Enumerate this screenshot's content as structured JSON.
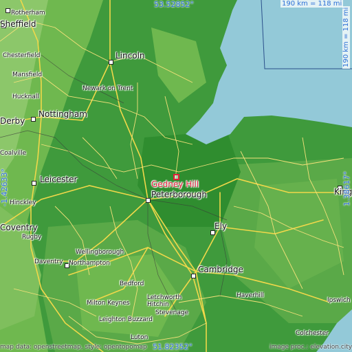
{
  "map": {
    "highlighted_place": "Gedney Hill",
    "coordinates": {
      "top": "53.52852°",
      "bottom": "51.82352°",
      "left": "-1.42633°",
      "right": "1.38617°"
    },
    "scale": {
      "horizontal": "190 km = 118 mi",
      "vertical": "190 km = 118 mi"
    },
    "credits": {
      "left": "map data: openstreetmap, style: opentopomap",
      "right": "image proc.: elevation.city"
    },
    "colors": {
      "sea": "#93c9d8",
      "lowland": "#3f9a3c",
      "upland": "#6fb84f",
      "roads": "#f1d84a",
      "highlight": "#e0203a",
      "coordinate_text": "#2b6fd6"
    },
    "cities": {
      "rotherham": "Rotherham",
      "sheffield": "Sheffield",
      "chesterfield": "Chesterfield",
      "mansfield": "Mansfield",
      "lincoln": "Lincoln",
      "newark": "Newark on Trent",
      "hucknall": "Hucknall",
      "derby": "Derby",
      "nottingham": "Nottingham",
      "coalville": "Coalville",
      "leicester": "Leicester",
      "hinckley": "Hinckley",
      "peterborough": "Peterborough",
      "kings_lynn": "King's Lynn",
      "ely": "Ely",
      "coventry": "Coventry",
      "rugby": "Rugby",
      "wellingborough": "Wellingborough",
      "daventry": "Daventry",
      "northampton": "Northampton",
      "cambridge": "Cambridge",
      "bedford": "Bedford",
      "haverhill": "Haverhill",
      "ipswich": "Ipswich",
      "milton_keynes": "Milton Keynes",
      "letchworth": "Letchworth",
      "hitchin": "Hitchin",
      "leighton_buzzard": "Leighton Buzzard",
      "stevenage": "Stevenage",
      "luton": "Luton",
      "colchester": "Colchester"
    }
  }
}
